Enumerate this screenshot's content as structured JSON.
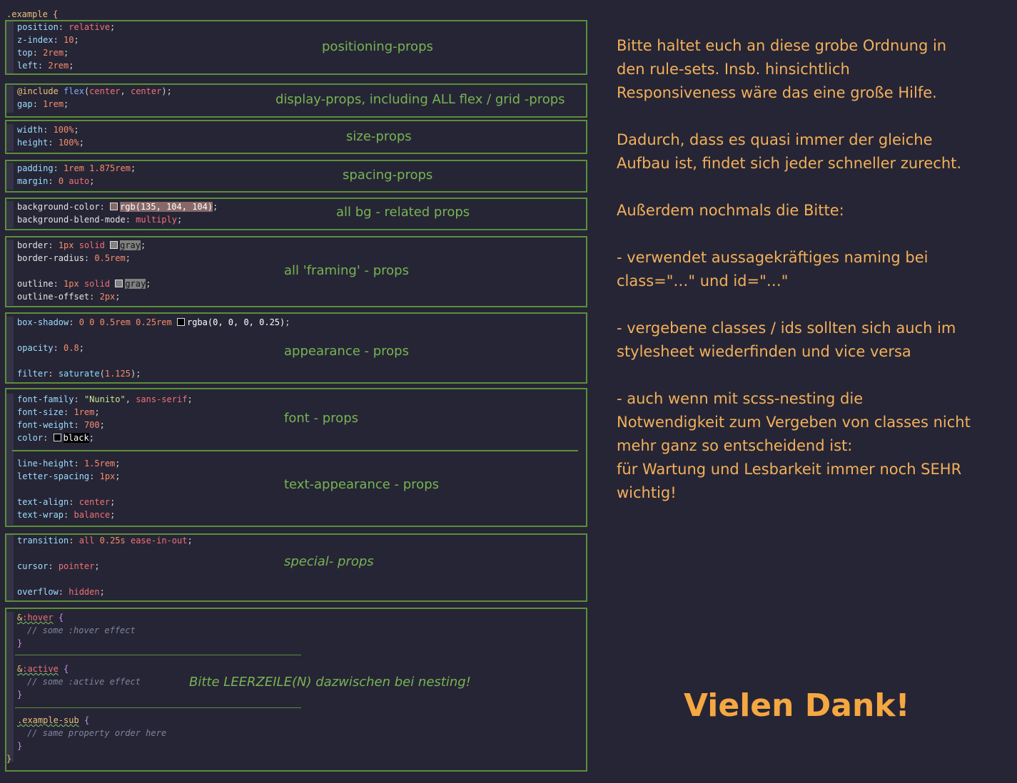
{
  "code": {
    "selector_open": ".example {",
    "closing": "}",
    "lines": {
      "position": {
        "prop": "position",
        "val": "relative"
      },
      "zindex": {
        "prop": "z-index",
        "val": "10"
      },
      "top": {
        "prop": "top",
        "val": "2rem"
      },
      "left": {
        "prop": "left",
        "val": "2rem"
      },
      "include": {
        "kw": "@include",
        "fn": "flex",
        "args1": "center",
        "args2": "center"
      },
      "gap": {
        "prop": "gap",
        "val": "1rem"
      },
      "width": {
        "prop": "width",
        "val": "100%"
      },
      "height": {
        "prop": "height",
        "val": "100%"
      },
      "padding": {
        "prop": "padding",
        "val": "1rem 1.875rem"
      },
      "margin": {
        "prop": "margin",
        "val1": "0",
        "val2": "auto"
      },
      "bgcolor": {
        "prop": "background-color",
        "val": "rgb(135, 104, 104)"
      },
      "blend": {
        "prop": "background-blend-mode",
        "val": "multiply"
      },
      "border": {
        "prop": "border",
        "val1": "1px",
        "val2": "solid",
        "val3": "gray"
      },
      "radius": {
        "prop": "border-radius",
        "val": "0.5rem"
      },
      "outline": {
        "prop": "outline",
        "val1": "1px",
        "val2": "solid",
        "val3": "gray"
      },
      "outline_offset": {
        "prop": "outline-offset",
        "val": "2px"
      },
      "shadow": {
        "prop": "box-shadow",
        "val": "0 0 0.5rem 0.25rem",
        "color": "rgba(0, 0, 0, 0.25)"
      },
      "opacity": {
        "prop": "opacity",
        "val": "0.8"
      },
      "filter": {
        "prop": "filter",
        "fn": "saturate",
        "arg": "1.125"
      },
      "font_family": {
        "prop": "font-family",
        "str": "\"Nunito\"",
        "val": "sans-serif"
      },
      "font_size": {
        "prop": "font-size",
        "val": "1rem"
      },
      "font_weight": {
        "prop": "font-weight",
        "val": "700"
      },
      "color": {
        "prop": "color",
        "val": "black"
      },
      "line_height": {
        "prop": "line-height",
        "val": "1.5rem"
      },
      "letter_spacing": {
        "prop": "letter-spacing",
        "val": "1px"
      },
      "text_align": {
        "prop": "text-align",
        "val": "center"
      },
      "text_wrap": {
        "prop": "text-wrap",
        "val": "balance"
      },
      "transition": {
        "prop": "transition",
        "val1": "all",
        "val2": "0.25s",
        "val3": "ease-in-out"
      },
      "cursor": {
        "prop": "cursor",
        "val": "pointer"
      },
      "overflow": {
        "prop": "overflow",
        "val": "hidden"
      },
      "hover_sel": {
        "amp": "&",
        "pseudo": ":hover"
      },
      "hover_comment": "// some :hover effect",
      "active_sel": {
        "amp": "&",
        "pseudo": ":active"
      },
      "active_comment": "// some :active effect",
      "sub_sel": ".example-sub",
      "sub_comment": "// same property order here"
    }
  },
  "labels": {
    "positioning": "positioning-props",
    "display": "display-props, including ALL flex / grid -props",
    "size": "size-props",
    "spacing": "spacing-props",
    "bg": "all bg - related props",
    "framing": "all 'framing' - props",
    "appearance": "appearance - props",
    "font": "font - props",
    "text_appearance": "text-appearance - props",
    "special": "special- props",
    "nesting": "Bitte LEERZEILE(N) dazwischen bei nesting!"
  },
  "notes": {
    "p1": "Bitte haltet euch an diese grobe Ordnung in den rule-sets. Insb. hinsichtlich Responsiveness wäre das eine große Hilfe.",
    "p2": "Dadurch, dass es quasi immer der gleiche Aufbau ist, findet sich jeder schneller zurecht.",
    "p3": "Außerdem nochmals die Bitte:",
    "p4": "- verwendet aussagekräftiges naming bei class=\"…\" und id=\"…\"",
    "p5": "- vergebene classes / ids sollten sich auch im stylesheet wiederfinden und vice versa",
    "p6a": "- auch wenn mit scss-nesting die Notwendigkeit zum Vergeben von classes nicht mehr ganz so entscheidend ist:",
    "p6b": "für Wartung und Lesbarkeit immer noch SEHR wichtig!"
  },
  "thanks": "Vielen Dank!"
}
